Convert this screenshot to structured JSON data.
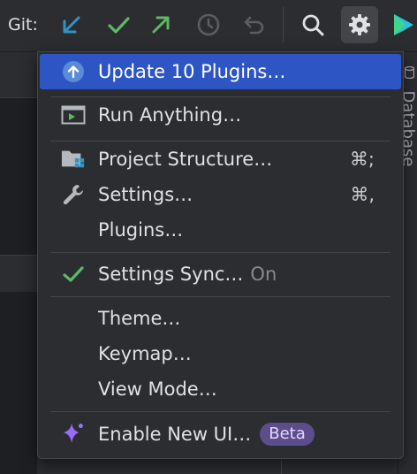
{
  "toolbar": {
    "git_label": "Git:",
    "buttons": [
      {
        "name": "update-project-icon",
        "color": "#3592c4"
      },
      {
        "name": "commit-icon",
        "color": "#5fb865"
      },
      {
        "name": "push-icon",
        "color": "#5fb865"
      },
      {
        "name": "history-icon",
        "color": "#5a5d63"
      },
      {
        "name": "rollback-icon",
        "color": "#5a5d63"
      },
      {
        "name": "search-icon",
        "color": "#dfe1e5"
      },
      {
        "name": "gear-icon",
        "color": "#dfe1e5"
      }
    ]
  },
  "side_tab": {
    "label": "Database"
  },
  "menu": {
    "items": [
      {
        "id": "update",
        "label": "Update 10 Plugins…",
        "icon": "arrow-up-circle-icon",
        "selected": true
      },
      {
        "id": "run",
        "label": "Run Anything…",
        "icon": "run-anything-icon"
      },
      {
        "id": "project-structure",
        "label": "Project Structure…",
        "shortcut": "⌘;",
        "icon": "project-structure-icon"
      },
      {
        "id": "settings",
        "label": "Settings…",
        "shortcut": "⌘,",
        "icon": "wrench-icon"
      },
      {
        "id": "plugins",
        "label": "Plugins…"
      },
      {
        "id": "settings-sync",
        "label": "Settings Sync…",
        "suffix": "On",
        "icon": "checkmark-icon"
      },
      {
        "id": "theme",
        "label": "Theme…"
      },
      {
        "id": "keymap",
        "label": "Keymap…"
      },
      {
        "id": "view-mode",
        "label": "View Mode…"
      },
      {
        "id": "new-ui",
        "label": "Enable New UI…",
        "badge": "Beta",
        "icon": "sparkle-icon"
      }
    ]
  },
  "colors": {
    "accent": "#2e55c4",
    "success": "#5fb865",
    "badge_bg": "#5e4d8c"
  }
}
